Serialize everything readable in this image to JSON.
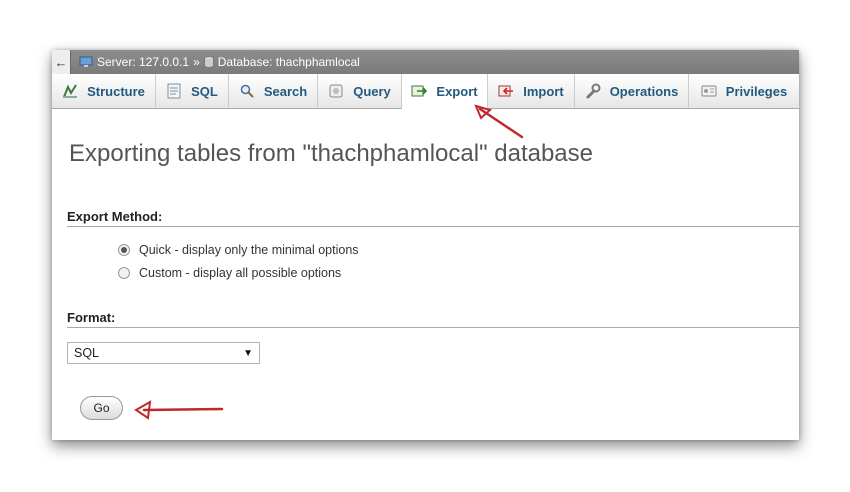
{
  "breadcrumb": {
    "back_symbol": "←",
    "server_label": "Server: 127.0.0.1",
    "separator": "»",
    "database_label": "Database: thachphamlocal"
  },
  "tabs": [
    {
      "label": "Structure",
      "icon": "structure-icon"
    },
    {
      "label": "SQL",
      "icon": "sql-icon"
    },
    {
      "label": "Search",
      "icon": "search-icon"
    },
    {
      "label": "Query",
      "icon": "query-icon"
    },
    {
      "label": "Export",
      "icon": "export-icon",
      "active": true
    },
    {
      "label": "Import",
      "icon": "import-icon"
    },
    {
      "label": "Operations",
      "icon": "wrench-icon"
    },
    {
      "label": "Privileges",
      "icon": "privileges-icon"
    }
  ],
  "page_title": "Exporting tables from \"thachphamlocal\" database",
  "export_method": {
    "heading": "Export Method:",
    "options": [
      {
        "label": "Quick - display only the minimal options",
        "checked": true
      },
      {
        "label": "Custom - display all possible options",
        "checked": false
      }
    ]
  },
  "format": {
    "heading": "Format:",
    "selected": "SQL"
  },
  "go_button": "Go",
  "colors": {
    "tab_text": "#235a81",
    "topbar": "#858585",
    "annotation_arrow": "#c0282d"
  }
}
